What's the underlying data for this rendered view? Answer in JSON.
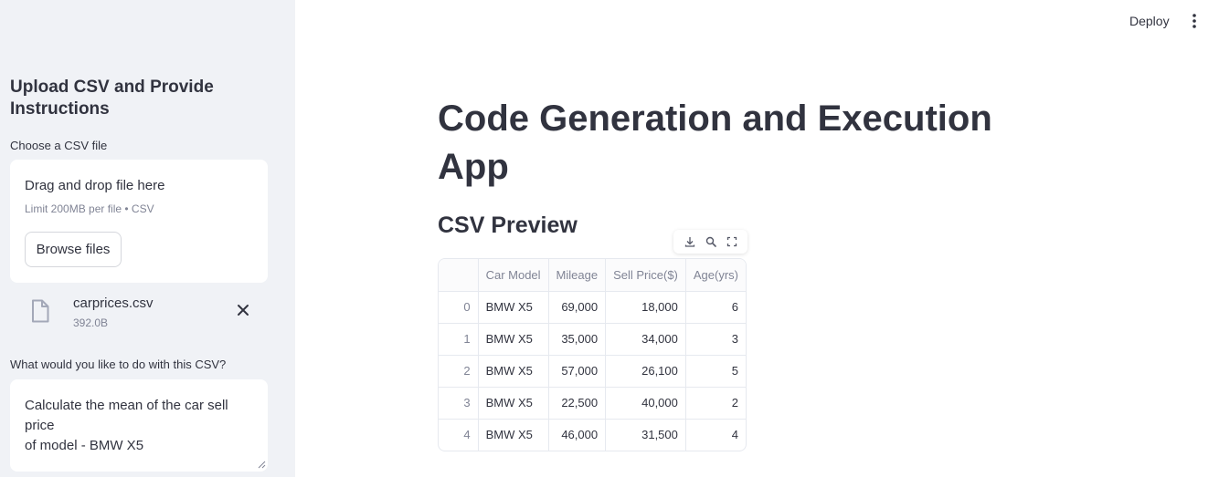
{
  "sidebar": {
    "heading": "Upload CSV and Provide Instructions",
    "file_label": "Choose a CSV file",
    "dropzone": {
      "title": "Drag and drop file here",
      "limit": "Limit 200MB per file • CSV",
      "browse_label": "Browse files"
    },
    "uploaded_file": {
      "name": "carprices.csv",
      "size": "392.0B",
      "icon": "file-icon"
    },
    "instruction_label": "What would you like to do with this CSV?",
    "instruction_value": "Calculate the mean of the car sell price\nof model - BMW X5"
  },
  "header": {
    "deploy_label": "Deploy",
    "menu_icon": "kebab-menu-icon"
  },
  "main": {
    "title": "Code Generation and Execution App",
    "preview_heading": "CSV Preview",
    "toolbar_icons": [
      "download-icon",
      "search-icon",
      "fullscreen-icon"
    ],
    "table": {
      "columns": [
        "",
        "Car Model",
        "Mileage",
        "Sell Price($)",
        "Age(yrs)"
      ],
      "rows": [
        [
          "0",
          "BMW X5",
          "69,000",
          "18,000",
          "6"
        ],
        [
          "1",
          "BMW X5",
          "35,000",
          "34,000",
          "3"
        ],
        [
          "2",
          "BMW X5",
          "57,000",
          "26,100",
          "5"
        ],
        [
          "3",
          "BMW X5",
          "22,500",
          "40,000",
          "2"
        ],
        [
          "4",
          "BMW X5",
          "46,000",
          "31,500",
          "4"
        ]
      ]
    }
  },
  "colors": {
    "sidebar_bg": "#f0f2f6",
    "text": "#31333f",
    "muted": "#808495",
    "border": "#e6e9ef"
  }
}
